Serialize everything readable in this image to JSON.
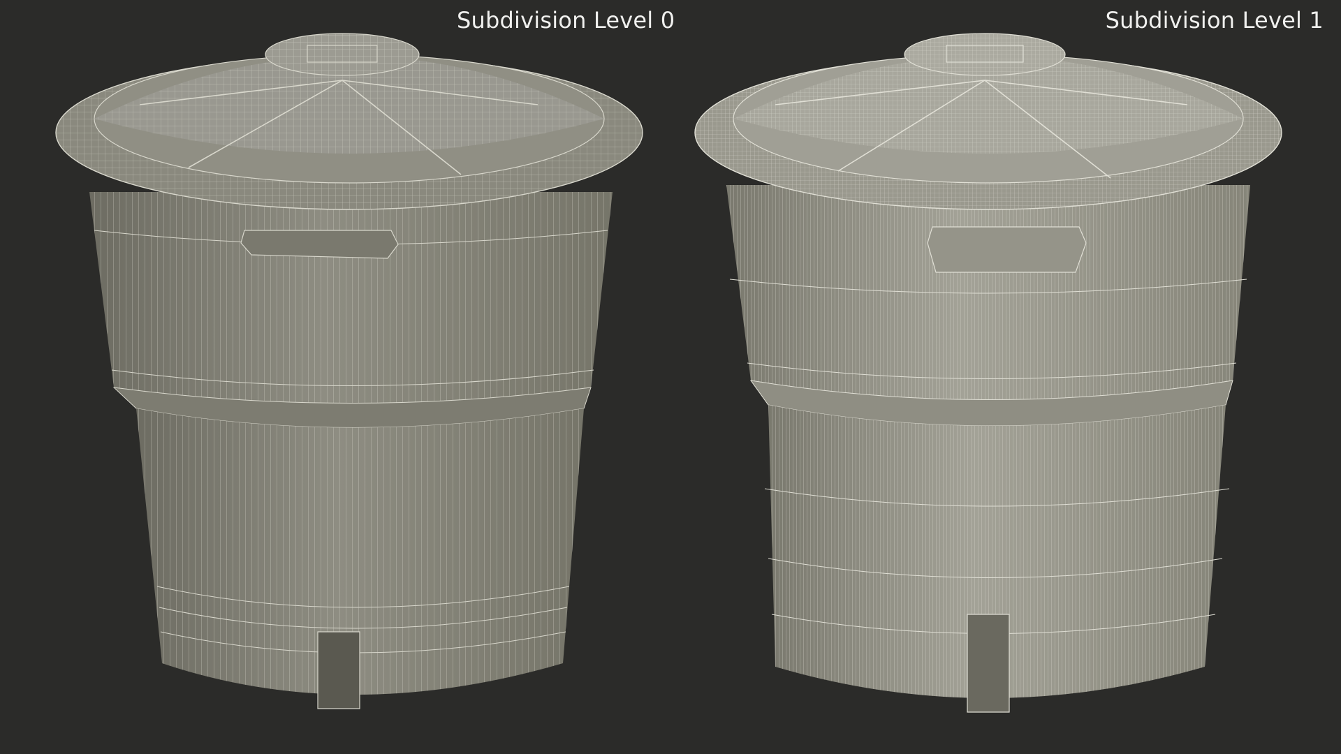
{
  "views": [
    {
      "id": "left",
      "label": "Subdivision Level 0",
      "subdivision_level": 0,
      "object": "round plastic water tank with domed lid",
      "icon": "wireframe-tank"
    },
    {
      "id": "right",
      "label": "Subdivision Level 1",
      "subdivision_level": 1,
      "object": "round plastic water tank with domed lid",
      "icon": "wireframe-tank"
    }
  ],
  "colors": {
    "background": "#2b2b29",
    "surface": "#8c8b80",
    "surface_shade": "#6f6e64",
    "wire": "#d8d7cc",
    "label": "#f0f0ee"
  }
}
